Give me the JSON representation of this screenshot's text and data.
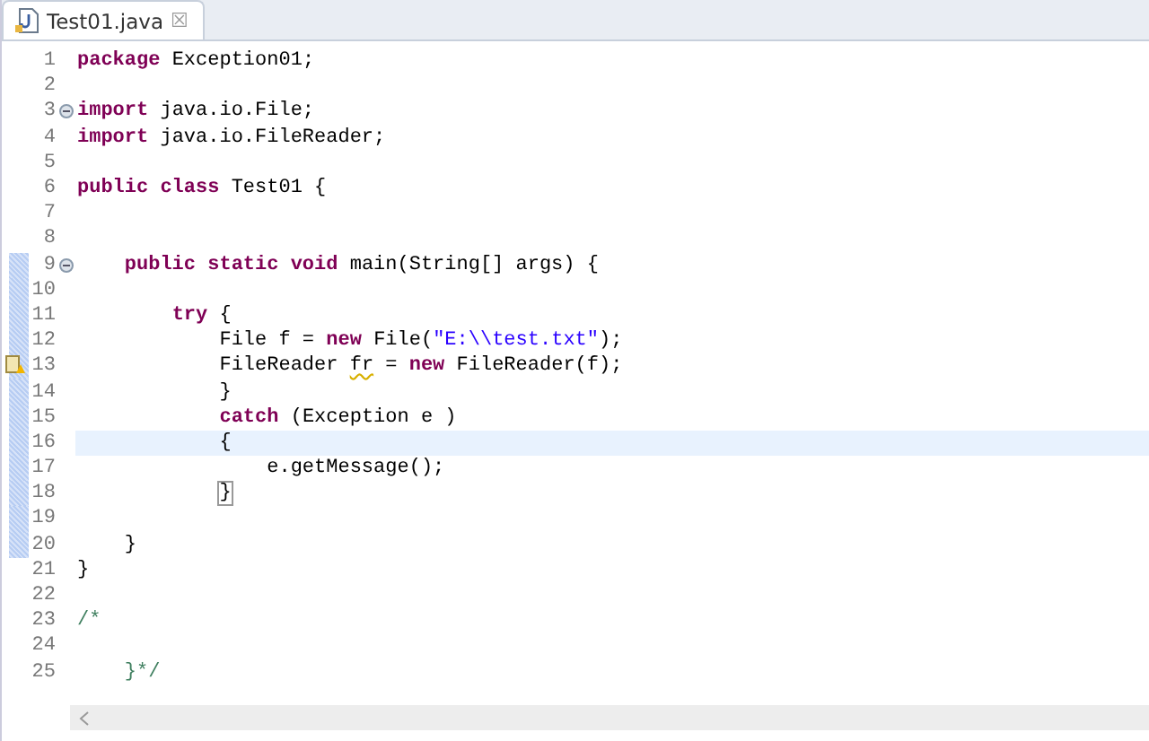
{
  "tab": {
    "title": "Test01.java",
    "close": "☒"
  },
  "lines": [
    {
      "number": "1",
      "changed": false,
      "current": false,
      "tokens": [
        {
          "text": "package",
          "kind": "keyword"
        },
        {
          "text": " Exception01;",
          "kind": "plain"
        }
      ]
    },
    {
      "number": "2",
      "changed": false,
      "current": false
    },
    {
      "number": "3",
      "changed": false,
      "current": false,
      "kind": "fold",
      "tokens": [
        {
          "text": "import",
          "kind": "keyword"
        },
        {
          "text": " java.io.File;",
          "kind": "plain"
        }
      ]
    },
    {
      "number": "4",
      "changed": false,
      "current": false,
      "tokens": [
        {
          "text": "import",
          "kind": "keyword"
        },
        {
          "text": " java.io.FileReader;",
          "kind": "plain"
        }
      ]
    },
    {
      "number": "5",
      "changed": false,
      "current": false
    },
    {
      "number": "6",
      "changed": false,
      "current": false,
      "tokens": [
        {
          "text": "public class",
          "kind": "keyword"
        },
        {
          "text": " Test01 {",
          "kind": "plain"
        }
      ]
    },
    {
      "number": "7",
      "changed": false,
      "current": false
    },
    {
      "number": "8",
      "changed": false,
      "current": false
    },
    {
      "number": "9",
      "changed": true,
      "current": false,
      "kind": "fold",
      "tokens": [
        {
          "text": "    public static void",
          "kind": "keyword"
        },
        {
          "text": " main(String[] args) {",
          "kind": "plain"
        }
      ]
    },
    {
      "number": "10",
      "changed": true,
      "current": false
    },
    {
      "number": "11",
      "changed": true,
      "current": false,
      "tokens": [
        {
          "text": "        try",
          "kind": "keyword"
        },
        {
          "text": " {",
          "kind": "plain"
        }
      ]
    },
    {
      "number": "12",
      "changed": true,
      "current": false,
      "tokens": [
        {
          "text": "            File f = ",
          "kind": "plain"
        },
        {
          "text": "new",
          "kind": "keyword"
        },
        {
          "text": " File(",
          "kind": "plain"
        },
        {
          "text": "\"E:\\\\test.txt\"",
          "kind": "string"
        },
        {
          "text": ");",
          "kind": "plain"
        }
      ]
    },
    {
      "number": "13",
      "changed": true,
      "current": false,
      "kind": "warning",
      "tokens": [
        {
          "text": "            FileReader ",
          "kind": "plain"
        },
        {
          "text": "fr",
          "kind": "warning"
        },
        {
          "text": " = ",
          "kind": "plain"
        },
        {
          "text": "new",
          "kind": "keyword"
        },
        {
          "text": " FileReader(f);",
          "kind": "plain"
        }
      ]
    },
    {
      "number": "14",
      "changed": true,
      "current": false,
      "tokens": [
        {
          "text": "            }",
          "kind": "plain"
        }
      ]
    },
    {
      "number": "15",
      "changed": true,
      "current": false,
      "tokens": [
        {
          "text": "            catch",
          "kind": "keyword"
        },
        {
          "text": " (Exception e )",
          "kind": "plain"
        }
      ]
    },
    {
      "number": "16",
      "changed": true,
      "current": true,
      "tokens": [
        {
          "text": "            {",
          "kind": "plain"
        }
      ]
    },
    {
      "number": "17",
      "changed": true,
      "current": false,
      "tokens": [
        {
          "text": "                e.getMessage();",
          "kind": "plain"
        }
      ]
    },
    {
      "number": "18",
      "changed": true,
      "current": false,
      "tokens": [
        {
          "text": "            }",
          "kind": "bracket"
        }
      ]
    },
    {
      "number": "19",
      "changed": true,
      "current": false
    },
    {
      "number": "20",
      "changed": true,
      "current": false,
      "tokens": [
        {
          "text": "    }",
          "kind": "plain"
        }
      ]
    },
    {
      "number": "21",
      "changed": false,
      "current": false,
      "tokens": [
        {
          "text": "}",
          "kind": "plain"
        }
      ]
    },
    {
      "number": "22",
      "changed": false,
      "current": false
    },
    {
      "number": "23",
      "changed": false,
      "current": false,
      "tokens": [
        {
          "text": "/*",
          "kind": "comment"
        }
      ]
    },
    {
      "number": "24",
      "changed": false,
      "current": false
    },
    {
      "number": "25",
      "changed": false,
      "current": false,
      "tokens": [
        {
          "text": "    }*/",
          "kind": "comment"
        }
      ]
    }
  ]
}
